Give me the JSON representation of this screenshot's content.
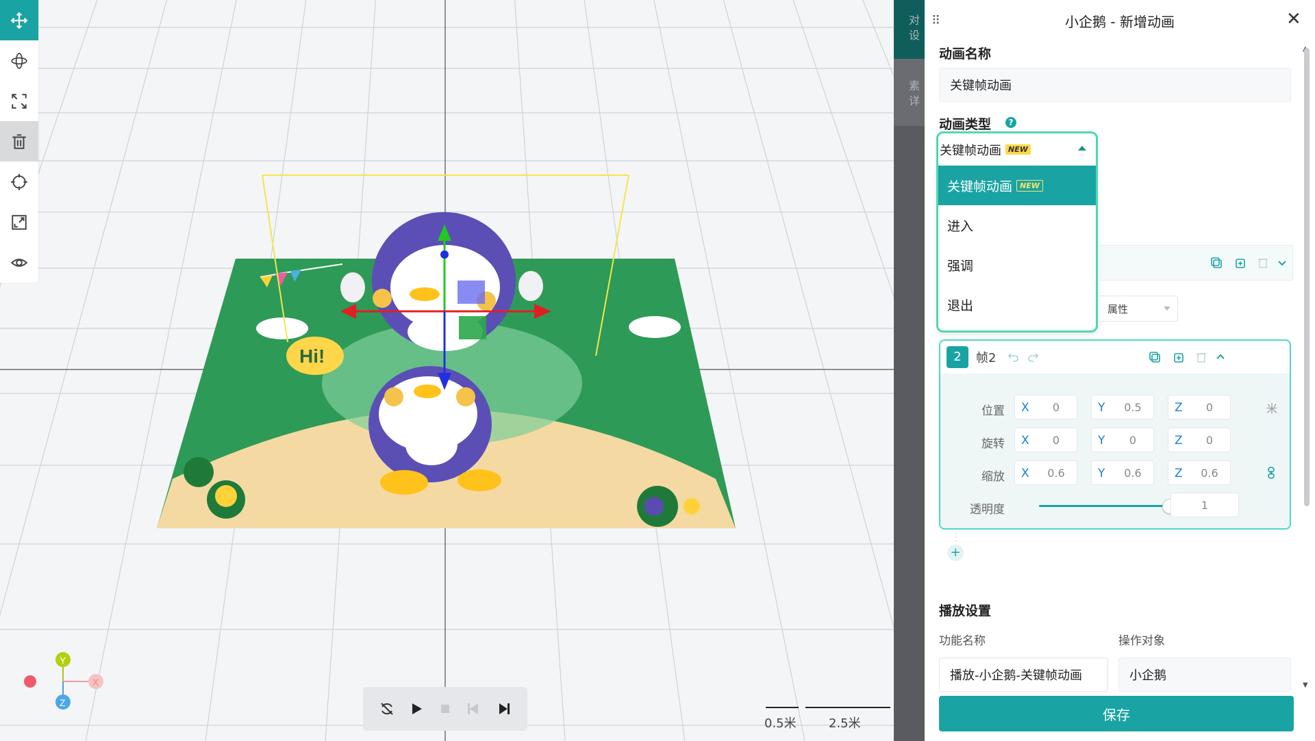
{
  "colors": {
    "accent": "#1aa3a3",
    "highlight": "#4ed8b0",
    "badge": "#ffd84a"
  },
  "toolbar": {
    "tools": [
      "move-icon",
      "rotate-icon",
      "scale-icon",
      "delete-icon",
      "target-icon",
      "fit-icon",
      "view-icon"
    ]
  },
  "axis_gizmo": {
    "x": "X",
    "y": "Y",
    "z": "Z"
  },
  "scale_ruler": {
    "small": "0.5米",
    "large": "2.5米"
  },
  "scene": {
    "poster_text": "Hi!"
  },
  "back_strip": {
    "line1": "对",
    "line2": "设",
    "line3": "素",
    "line4": "详"
  },
  "panel": {
    "title": "小企鹅 - 新增动画",
    "name_label": "动画名称",
    "name_value": "关键帧动画",
    "type_label": "动画类型",
    "type_help": "?",
    "type_selected": "关键帧动画",
    "new_badge": "NEW",
    "type_options": [
      "关键帧动画",
      "进入",
      "强调",
      "退出"
    ],
    "attr_select_tail": "属性",
    "frame": {
      "number": "2",
      "name": "帧2",
      "position_label": "位置",
      "rotation_label": "旋转",
      "scale_label": "缩放",
      "opacity_label": "透明度",
      "axis_x": "X",
      "axis_y": "Y",
      "axis_z": "Z",
      "position": {
        "x": "0",
        "y": "0.5",
        "z": "0"
      },
      "rotation": {
        "x": "0",
        "y": "0",
        "z": "0"
      },
      "scale": {
        "x": "0.6",
        "y": "0.6",
        "z": "0.6"
      },
      "unit": "米",
      "opacity": "1",
      "opacity_level": 1
    },
    "add_frame": "+",
    "playback_heading": "播放设置",
    "func_name_label": "功能名称",
    "func_name_value": "播放-小企鹅-关键帧动画",
    "target_label": "操作对象",
    "target_value": "小企鹅",
    "save": "保存"
  }
}
